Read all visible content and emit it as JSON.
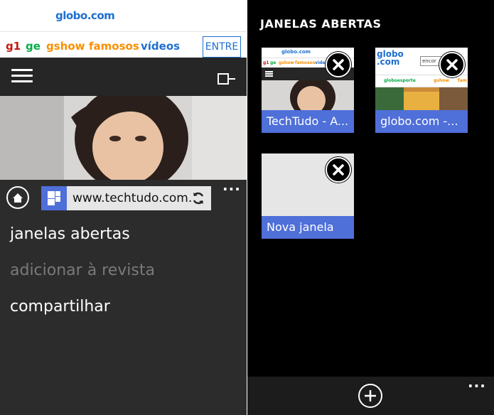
{
  "left": {
    "site_logo": "globo.com",
    "nav": [
      {
        "label": "g1",
        "color": "#c4170c"
      },
      {
        "label": "ge",
        "color": "#06aa48"
      },
      {
        "label": "gshow",
        "color": "#f98f00"
      },
      {
        "label": "famosos",
        "color": "#f98f00"
      },
      {
        "label": "vídeos",
        "color": "#1e6fd0"
      }
    ],
    "login_label": "ENTRE",
    "address_bar": {
      "url": "www.techtudo.com.b"
    },
    "menu": [
      {
        "label": "janelas abertas",
        "enabled": true
      },
      {
        "label": "adicionar à revista",
        "enabled": false
      },
      {
        "label": "compartilhar",
        "enabled": true
      }
    ],
    "more_label": "..."
  },
  "right": {
    "title": "JANELAS ABERTAS",
    "tabs": [
      {
        "caption": "TechTudo - A..."
      },
      {
        "caption": "globo.com -..."
      },
      {
        "caption": "Nova janela"
      }
    ],
    "thumb_texts": {
      "t1_logo": "globo.com",
      "t1_nav": [
        "g1",
        "ge",
        "gshow",
        "famosos",
        "vide"
      ],
      "t2_logo_top": "globo",
      "t2_logo_bottom": ".com",
      "t2_search": "encor",
      "t2_nav": [
        "globoesporte",
        "gshow",
        "fam"
      ]
    },
    "more_label": "..."
  },
  "colors": {
    "accent": "#4f6fd9"
  }
}
